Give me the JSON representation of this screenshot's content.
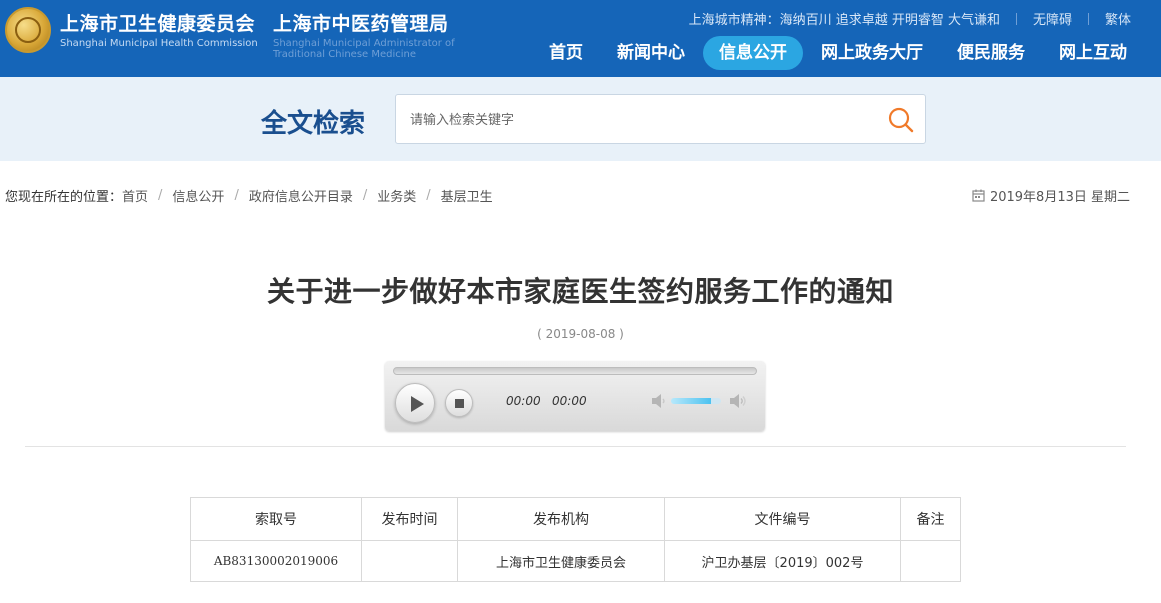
{
  "header": {
    "org1_cn": "上海市卫生健康委员会",
    "org1_en": "Shanghai Municipal Health Commission",
    "org2_cn": "上海市中医药管理局",
    "org2_en": "Shanghai Municipal Administrator of Traditional Chinese Medicine",
    "spirit": "上海城市精神：海纳百川 追求卓越 开明睿智 大气谦和",
    "accessibility": "无障碍",
    "traditional": "繁体",
    "bg_color": "#1565b8",
    "nav": [
      {
        "label": "首页",
        "active": false
      },
      {
        "label": "新闻中心",
        "active": false
      },
      {
        "label": "信息公开",
        "active": true
      },
      {
        "label": "网上政务大厅",
        "active": false
      },
      {
        "label": "便民服务",
        "active": false
      },
      {
        "label": "网上互动",
        "active": false
      }
    ]
  },
  "search": {
    "title": "全文检索",
    "placeholder": "请输入检索关键字",
    "icon": "search-icon"
  },
  "breadcrumb": {
    "prefix": "您现在所在的位置：",
    "items": [
      "首页",
      "信息公开",
      "政府信息公开目录",
      "业务类",
      "基层卫生"
    ]
  },
  "date_today": "2019年8月13日 星期二",
  "article": {
    "title": "关于进一步做好本市家庭医生签约服务工作的通知",
    "date": "( 2019-08-08 )"
  },
  "player": {
    "current_time": "00:00",
    "duration": "00:00",
    "progress": 0,
    "volume": 0.8
  },
  "info_table": {
    "headers": [
      "索取号",
      "发布时间",
      "发布机构",
      "文件编号",
      "备注"
    ],
    "row": [
      "AB83130002019006",
      "",
      "上海市卫生健康委员会",
      "沪卫办基层〔2019〕002号",
      ""
    ]
  }
}
